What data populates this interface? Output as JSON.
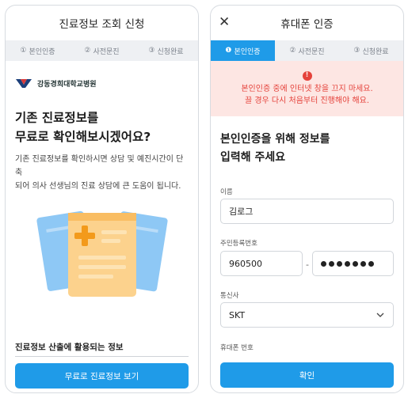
{
  "left": {
    "header_title": "진료정보 조회 신청",
    "steps": [
      {
        "num": "①",
        "label": "본인인증"
      },
      {
        "num": "②",
        "label": "사전문진"
      },
      {
        "num": "③",
        "label": "신청완료"
      }
    ],
    "hospital_name": "강동경희대학교병원",
    "title_line1": "기존 진료정보를",
    "title_line2": "무료로 확인해보시겠어요?",
    "desc_line1": "기존 진료정보를 확인하시면 상담 및 예진시간이 단축",
    "desc_line2": "되어 의사 선생님의 진료 상담에 큰 도움이 됩니다.",
    "info_title": "진료정보 산출에 활용되는 정보",
    "cta_label": "무료로 진료정보 보기"
  },
  "right": {
    "header_title": "휴대폰 인증",
    "steps": [
      {
        "num": "❶",
        "label": "본인인증"
      },
      {
        "num": "②",
        "label": "사전문진"
      },
      {
        "num": "③",
        "label": "신청완료"
      }
    ],
    "warning_icon": "!",
    "warning_line1": "본인인증 중에 인터넷 창을 끄지 마세요.",
    "warning_line2": "끌 경우 다시 처음부터 진행해야 해요.",
    "title_line1": "본인인증을 위해 정보를",
    "title_line2": "입력해 주세요",
    "name_label": "이름",
    "name_value": "김로그",
    "rrn_label": "주민등록번호",
    "rrn_front": "960500",
    "rrn_dash": "-",
    "carrier_label": "통신사",
    "carrier_value": "SKT",
    "phone_label": "휴대폰 번호",
    "confirm_label": "확인"
  },
  "colors": {
    "accent": "#1f9be8",
    "warning_bg": "#fde6e3",
    "warning_text": "#e5423b"
  }
}
